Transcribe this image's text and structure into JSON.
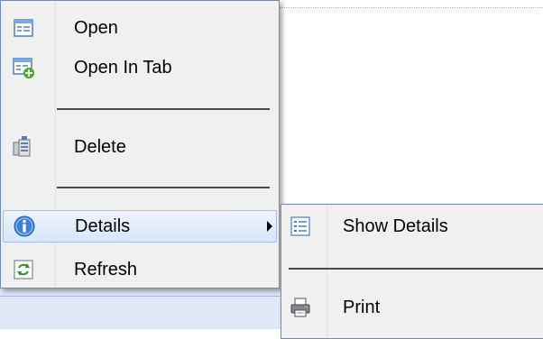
{
  "context_menu": {
    "items": [
      {
        "label": "Open",
        "icon": "open-icon"
      },
      {
        "label": "Open In Tab",
        "icon": "open-in-tab-icon"
      },
      {
        "label": "Delete",
        "icon": "delete-icon"
      },
      {
        "label": "Details",
        "icon": "info-icon",
        "has_submenu": true,
        "active": true
      },
      {
        "label": "Refresh",
        "icon": "refresh-icon"
      }
    ]
  },
  "submenu": {
    "items": [
      {
        "label": "Show Details",
        "icon": "list-icon"
      },
      {
        "label": "Print",
        "icon": "printer-icon"
      }
    ]
  },
  "colors": {
    "menu_bg": "#f0f0f0",
    "menu_border": "#718bb7",
    "active_bg": "#d6e6fb",
    "app_bg": "#dfe8f6"
  }
}
